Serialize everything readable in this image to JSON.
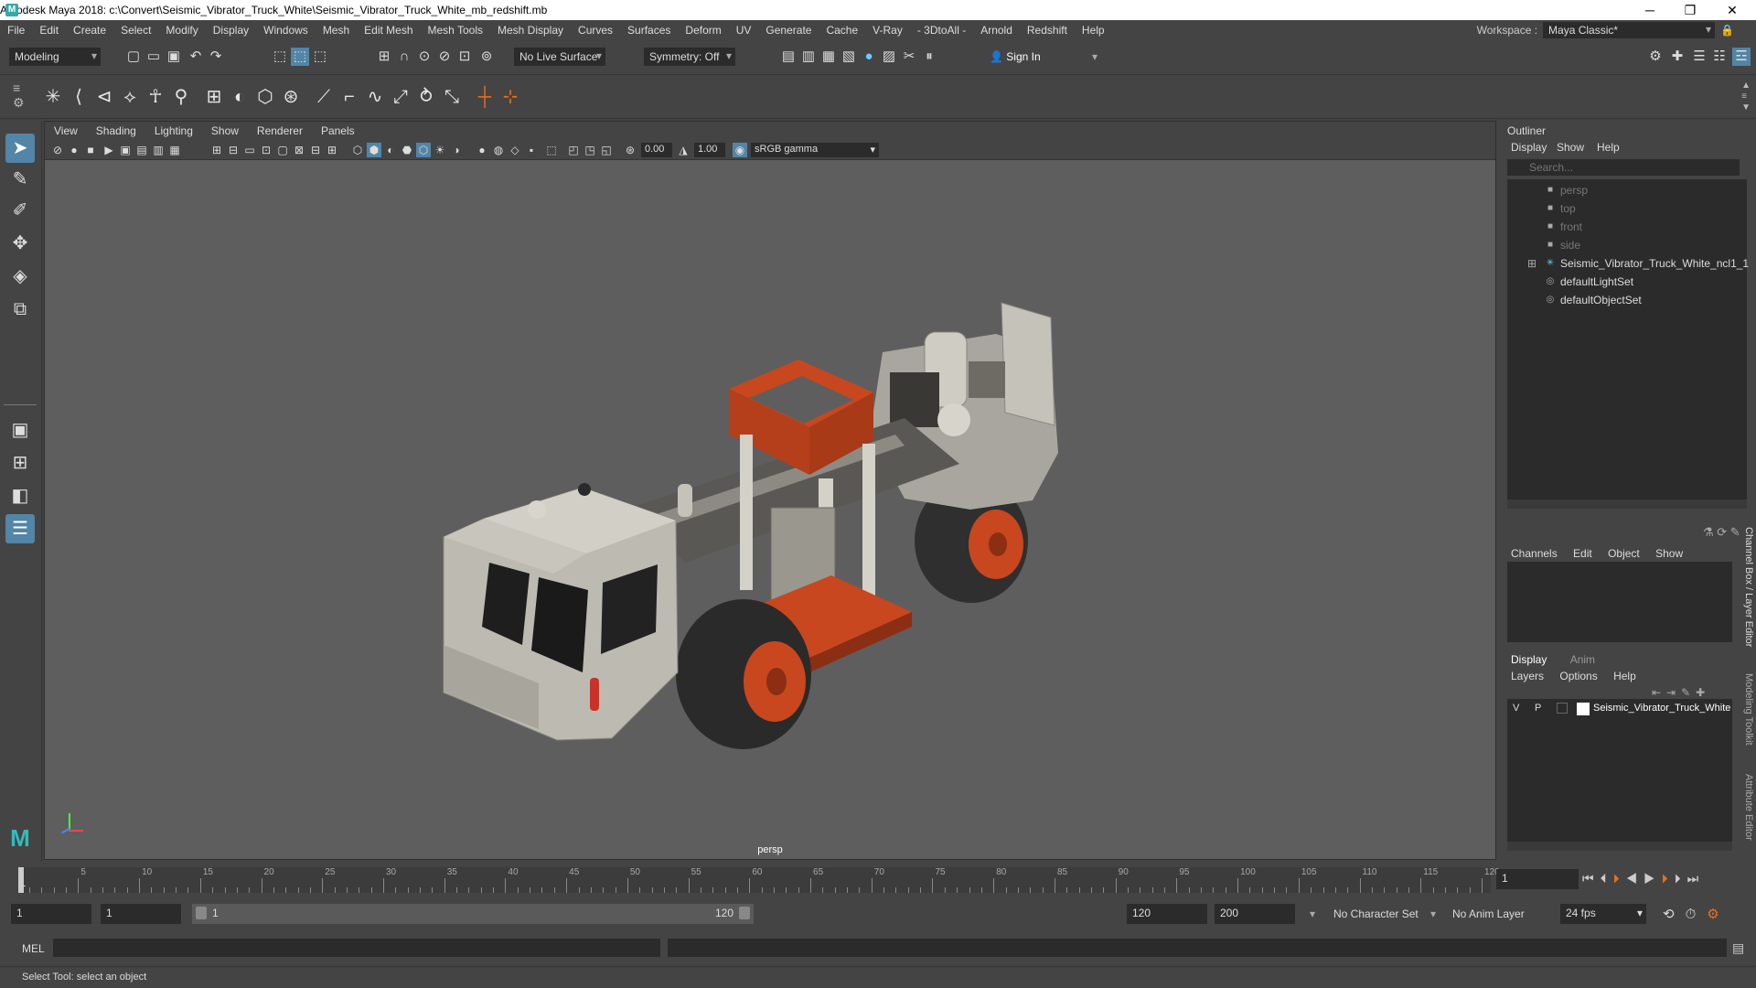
{
  "window": {
    "title": "Autodesk Maya 2018: c:\\Convert\\Seismic_Vibrator_Truck_White\\Seismic_Vibrator_Truck_White_mb_redshift.mb"
  },
  "menubar": {
    "items": [
      "File",
      "Edit",
      "Create",
      "Select",
      "Modify",
      "Display",
      "Windows",
      "Mesh",
      "Edit Mesh",
      "Mesh Tools",
      "Mesh Display",
      "Curves",
      "Surfaces",
      "Deform",
      "UV",
      "Generate",
      "Cache",
      "V-Ray",
      "- 3DtoAll -",
      "Arnold",
      "Redshift",
      "Help"
    ],
    "workspace_label": "Workspace :",
    "workspace_value": "Maya Classic*"
  },
  "statusline": {
    "mode": "Modeling",
    "live_surface": "No Live Surface",
    "symmetry": "Symmetry: Off",
    "sign_in": "Sign In"
  },
  "viewport": {
    "menus": [
      "View",
      "Shading",
      "Lighting",
      "Show",
      "Renderer",
      "Panels"
    ],
    "exposure": "0.00",
    "gamma": "1.00",
    "color_space": "sRGB gamma",
    "camera_label": "persp"
  },
  "outliner": {
    "title": "Outliner",
    "menus": [
      "Display",
      "Show",
      "Help"
    ],
    "search_placeholder": "Search...",
    "items": [
      {
        "label": "persp",
        "type": "camera"
      },
      {
        "label": "top",
        "type": "camera"
      },
      {
        "label": "front",
        "type": "camera"
      },
      {
        "label": "side",
        "type": "camera"
      },
      {
        "label": "Seismic_Vibrator_Truck_White_ncl1_1",
        "type": "group"
      },
      {
        "label": "defaultLightSet",
        "type": "set"
      },
      {
        "label": "defaultObjectSet",
        "type": "set"
      }
    ]
  },
  "channel_box": {
    "menus": [
      "Channels",
      "Edit",
      "Object",
      "Show"
    ]
  },
  "layer_editor": {
    "tabs": [
      "Display",
      "Anim"
    ],
    "menus": [
      "Layers",
      "Options",
      "Help"
    ],
    "layer": {
      "v": "V",
      "p": "P",
      "name": "Seismic_Vibrator_Truck_White"
    }
  },
  "side_tabs": [
    "Channel Box / Layer Editor",
    "Modeling Toolkit",
    "Attribute Editor"
  ],
  "timeline": {
    "labels": [
      "5",
      "10",
      "15",
      "20",
      "25",
      "30",
      "35",
      "40",
      "45",
      "50",
      "55",
      "60",
      "65",
      "70",
      "75",
      "80",
      "85",
      "90",
      "95",
      "100",
      "105",
      "110",
      "115",
      "120"
    ],
    "first_frame": "1",
    "current_frame": "1"
  },
  "range": {
    "start": "1",
    "playback_start": "1",
    "slider_start": "1",
    "slider_end": "120",
    "playback_end": "120",
    "end": "200",
    "character_set": "No Character Set",
    "anim_layer": "No Anim Layer",
    "fps": "24 fps"
  },
  "command_line": {
    "label": "MEL"
  },
  "help_line": {
    "text": "Select Tool: select an object"
  },
  "colors": {
    "accent": "#5285a6",
    "truck_orange": "#c8471e",
    "truck_white": "#bdbab2"
  }
}
